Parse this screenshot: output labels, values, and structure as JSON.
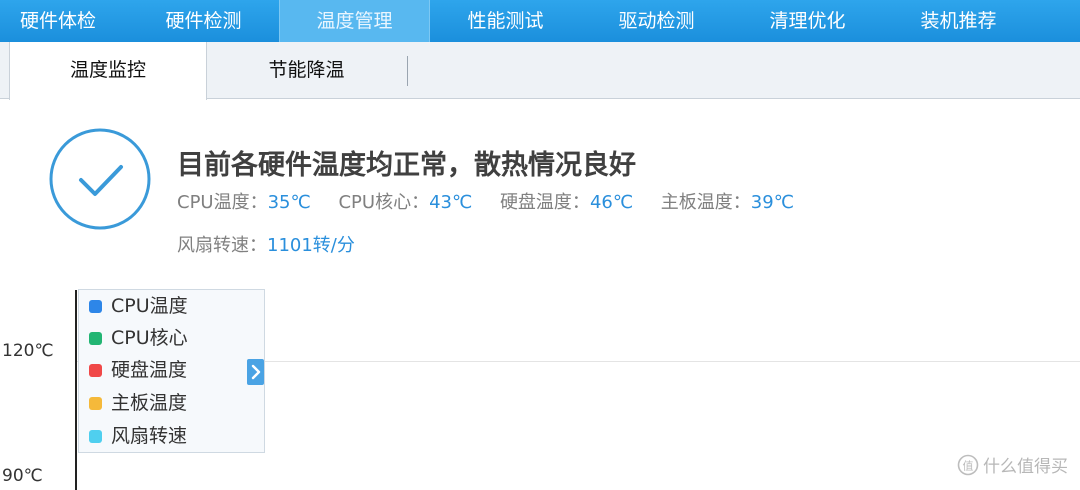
{
  "nav": {
    "items": [
      {
        "label": "硬件体检"
      },
      {
        "label": "硬件检测"
      },
      {
        "label": "温度管理"
      },
      {
        "label": "性能测试"
      },
      {
        "label": "驱动检测"
      },
      {
        "label": "清理优化"
      },
      {
        "label": "装机推荐"
      }
    ],
    "active": "温度管理"
  },
  "subtabs": {
    "items": [
      {
        "label": "温度监控"
      },
      {
        "label": "节能降温"
      }
    ],
    "active": "温度监控"
  },
  "status": {
    "icon": "check-circle-icon",
    "title": "目前各硬件温度均正常，散热情况良好",
    "readings": [
      {
        "label": "CPU温度：",
        "value": "35℃"
      },
      {
        "label": "CPU核心：",
        "value": "43℃"
      },
      {
        "label": "硬盘温度：",
        "value": "46℃"
      },
      {
        "label": "主板温度：",
        "value": "39℃"
      }
    ],
    "fan": {
      "label": "风扇转速：",
      "value": "1101转/分"
    }
  },
  "chart_data": {
    "type": "line",
    "yticks": [
      "120℃",
      "90℃"
    ],
    "legend": [
      {
        "name": "CPU温度",
        "color": "#2d86e8"
      },
      {
        "name": "CPU核心",
        "color": "#22b573"
      },
      {
        "name": "硬盘温度",
        "color": "#f04848"
      },
      {
        "name": "主板温度",
        "color": "#f5b93a"
      },
      {
        "name": "风扇转速",
        "color": "#4fcfef"
      }
    ],
    "series": [],
    "grid": true,
    "legend_placement": "top-left"
  },
  "colors": {
    "accent": "#1b8fdc",
    "value_text": "#2a8fdc",
    "title_text": "#404040"
  },
  "watermark": {
    "text": "什么值得买",
    "icon": "smzdm-logo-icon"
  }
}
